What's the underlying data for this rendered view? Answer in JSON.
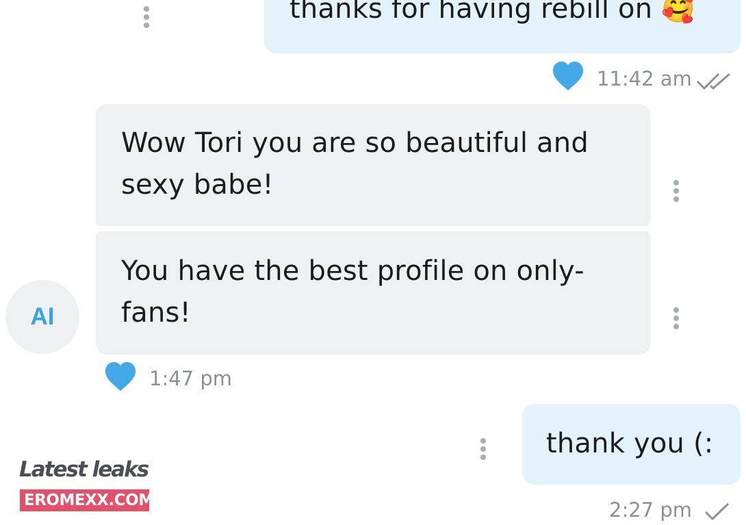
{
  "messages": {
    "m1": {
      "text": "thanks for having rebill on 🥰",
      "time": "11:42 am",
      "liked": true,
      "status": "read"
    },
    "m2": {
      "text": "Wow Tori you are so beautiful and sexy babe!"
    },
    "m3": {
      "text": "You have the best profile on only-fans!",
      "time": "1:47 pm",
      "liked": true
    },
    "m4": {
      "text": "thank you (:",
      "time": "2:27 pm",
      "status": "sent"
    }
  },
  "sender": {
    "avatar_initials": "AI"
  },
  "watermark": {
    "title": "Latest leaks",
    "site": "EROMEXX.COM"
  },
  "colors": {
    "outgoing_bubble": "#e4f3fb",
    "incoming_bubble": "#eef1f3",
    "like_heart": "#43a9e6",
    "avatar_initials": "#3aa3e3",
    "watermark_badge": "#e4506a"
  },
  "icons": {
    "like": "heart-icon",
    "read": "double-check-icon",
    "sent": "single-check-icon",
    "more": "kebab-menu-icon"
  }
}
